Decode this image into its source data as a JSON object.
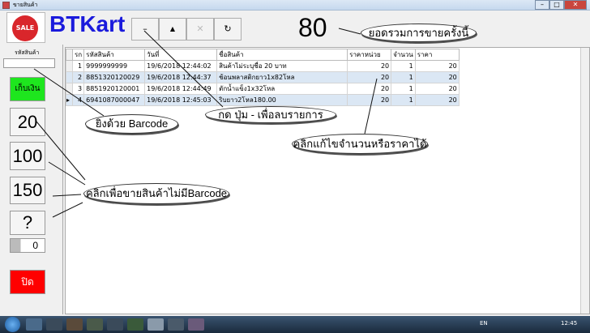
{
  "window": {
    "title": "ขายสินค้า"
  },
  "brand": {
    "logo_text": "SALE",
    "name": "BTKart"
  },
  "toolbar": {
    "buttons": [
      {
        "label": "–",
        "name": "delete-row-button"
      },
      {
        "label": "▲",
        "name": "up-button"
      },
      {
        "label": "✕",
        "name": "cancel-button"
      },
      {
        "label": "↻",
        "name": "refresh-button"
      }
    ]
  },
  "total": {
    "value": "80",
    "callout": "ยอดรวมการขายครั้งนี้"
  },
  "left": {
    "code_label": "รหัสสินค้า",
    "code_value": "",
    "pay": "เก็บเงิน",
    "quick": [
      "20",
      "100",
      "150",
      "?"
    ],
    "counter": "0",
    "close": "ปิด"
  },
  "grid": {
    "headers": [
      "รก",
      "รหัสสินค้า",
      "วันที่",
      "ชื่อสินค้า",
      "ราคาหน่วย",
      "จำนวน",
      "ราคา"
    ],
    "rows": [
      [
        "1",
        "9999999999",
        "19/6/2018 12:44:02",
        "สินค้าไม่ระบุชื่อ 20 บาท",
        "20",
        "1",
        "20"
      ],
      [
        "2",
        "8851320120029",
        "19/6/2018 12:44:37",
        "ช้อนพลาสติกยาว1x82โหล",
        "20",
        "1",
        "20"
      ],
      [
        "3",
        "8851920120001",
        "19/6/2018 12:44:49",
        "ตักน้ำแข็ง1x32โหล",
        "20",
        "1",
        "20"
      ],
      [
        "4",
        "6941087000047",
        "19/6/2018 12:45:03",
        "ริบยาว2โหล180.00",
        "20",
        "1",
        "20"
      ]
    ]
  },
  "callouts": {
    "barcode": "ยิงด้วย Barcode",
    "delete": "กด ปุ่ม - เพื่อลบรายการ",
    "edit": "คลิกแก้ไขจำนวนหรือราคาได้",
    "nobarcode": "คลิกเพื่อขายสินค้าไม่มีBarcode"
  },
  "taskbar": {
    "lang": "EN",
    "clock": "12:45"
  }
}
